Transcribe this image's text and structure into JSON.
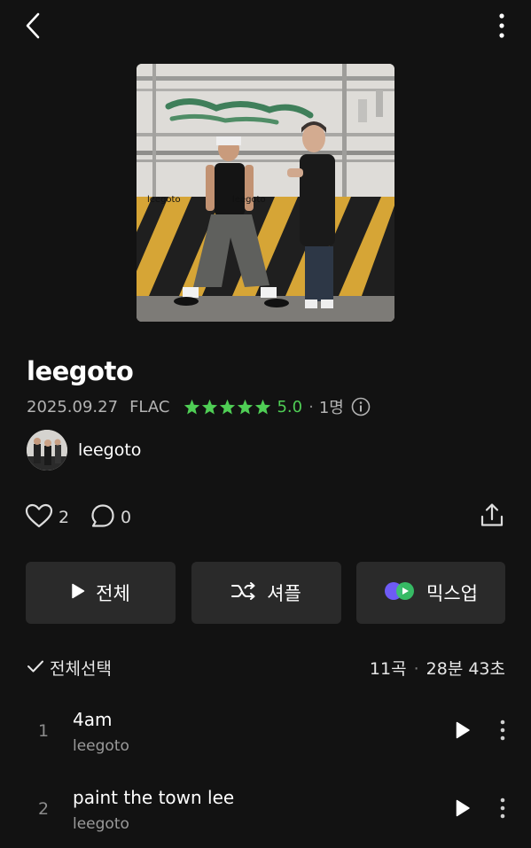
{
  "header": {
    "back_icon": "chevron-left-icon",
    "more_icon": "more-vertical-icon"
  },
  "album": {
    "title": "leegoto",
    "release_date": "2025.09.27",
    "format": "FLAC",
    "rating_stars": 5,
    "rating": "5.0",
    "separator": "·",
    "rating_count": "1명",
    "cover_texts": [
      "leegoto",
      "leegoto"
    ]
  },
  "artist": {
    "name": "leegoto"
  },
  "actions": {
    "likes": "2",
    "comments": "0",
    "share_icon": "share-icon"
  },
  "buttons": {
    "play_all": "전체",
    "shuffle": "셔플",
    "mixup": "믹스업"
  },
  "list": {
    "select_all": "전체선택",
    "track_count": "11곡",
    "separator": "·",
    "duration": "28분 43초"
  },
  "tracks": [
    {
      "number": "1",
      "title": "4am",
      "artist": "leegoto"
    },
    {
      "number": "2",
      "title": "paint the town lee",
      "artist": "leegoto"
    }
  ],
  "colors": {
    "background": "#121212",
    "button_bg": "#2a2a2a",
    "rating_green": "#4fce55",
    "secondary_text": "#b3b3b3"
  }
}
